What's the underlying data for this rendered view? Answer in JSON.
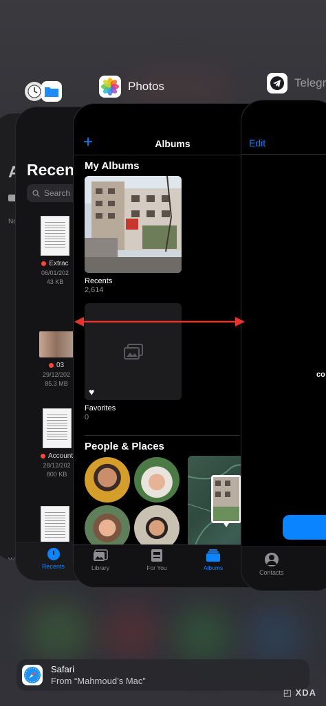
{
  "switcher": {
    "photos_label": "Photos",
    "telegram_label": "Telegr"
  },
  "files": {
    "title_partial": "Recen",
    "search_placeholder": "Search",
    "left_edge_letter": "A",
    "left_edge_no": "No",
    "left_edge_w": "W",
    "items": [
      {
        "name": "Extrac",
        "date": "06/01/202",
        "size": "43 KB",
        "kind": "doc"
      },
      {
        "name": "03",
        "date": "29/12/202",
        "size": "85.3 MB",
        "kind": "photo"
      },
      {
        "name": "Account",
        "date": "28/12/202",
        "size": "800 KB",
        "kind": "doc"
      }
    ],
    "tab_recents": "Recents"
  },
  "photos": {
    "nav_title": "Albums",
    "add_icon": "plus-icon",
    "my_albums_title": "My Albums",
    "albums": [
      {
        "name": "Recents",
        "count": "2,614"
      },
      {
        "name": "Favorites",
        "count": "0"
      }
    ],
    "people_places_title": "People & Places",
    "tabs": [
      {
        "label": "Library",
        "icon": "library-icon"
      },
      {
        "label": "For You",
        "icon": "for-you-icon"
      },
      {
        "label": "Albums",
        "icon": "albums-icon",
        "active": true
      }
    ]
  },
  "telegram": {
    "edit_label": "Edit",
    "partial_text": "co",
    "tab_contacts": "Contacts"
  },
  "handoff": {
    "title": "Safari",
    "subtitle": "From “Mahmoud’s Mac”"
  },
  "watermark": "XDA",
  "colors": {
    "accent": "#0a84ff",
    "arrow": "#e8322a",
    "red_tag": "#ff453a"
  }
}
